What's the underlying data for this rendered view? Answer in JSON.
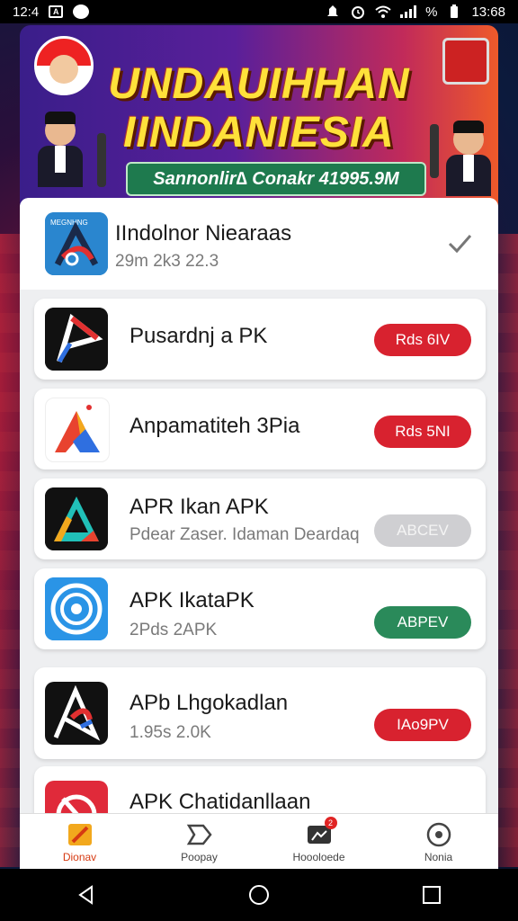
{
  "status_bar": {
    "time_left": "12:4",
    "time_right": "13:68",
    "battery": "%"
  },
  "banner": {
    "title_line1": "UNDAUIHHAN",
    "title_line2": "IINDANIESIA",
    "subtitle": "Sannonlir∆ Conakr 41995.9M"
  },
  "apps": [
    {
      "name": "IIndolnor Niearaas",
      "sub": "29m  2k3 22.3",
      "action": "",
      "action_color": "",
      "icon_label": "MEGNHNG"
    },
    {
      "name": "Pusardnj a PK",
      "sub": "",
      "action": "Rds 6IV",
      "action_color": "#d8222f"
    },
    {
      "name": "Anpamatiteh 3Pia",
      "sub": "",
      "action": "Rds 5NI",
      "action_color": "#d8222f"
    },
    {
      "name": "APR Ikan APK",
      "sub": "Pdear Zaser. Idaman Deardaq",
      "action": "ABCEV",
      "action_color": "#cfcfd2"
    },
    {
      "name": "APK IkataPK",
      "sub": "2Pds  2APK",
      "action": "ABPEV",
      "action_color": "#2a8a5a"
    },
    {
      "name": "APb Lhgokadlan",
      "sub": "1.95s  2.0K",
      "action": "IAo9PV",
      "action_color": "#d8222f"
    },
    {
      "name": "APK Chatidanllaan",
      "sub": "",
      "action": "",
      "action_color": ""
    }
  ],
  "bottom_nav": [
    {
      "label": "Dionav",
      "icon": "home-icon",
      "active": true
    },
    {
      "label": "Poopay",
      "icon": "chat-icon",
      "active": false
    },
    {
      "label": "Hoooloede",
      "icon": "downloads-icon",
      "active": false,
      "badge": "2"
    },
    {
      "label": "Nonia",
      "icon": "profile-icon",
      "active": false
    }
  ],
  "colors": {
    "accent_red": "#d8222f",
    "accent_green": "#2a8a5a",
    "banner_yellow": "#ffe13a"
  }
}
